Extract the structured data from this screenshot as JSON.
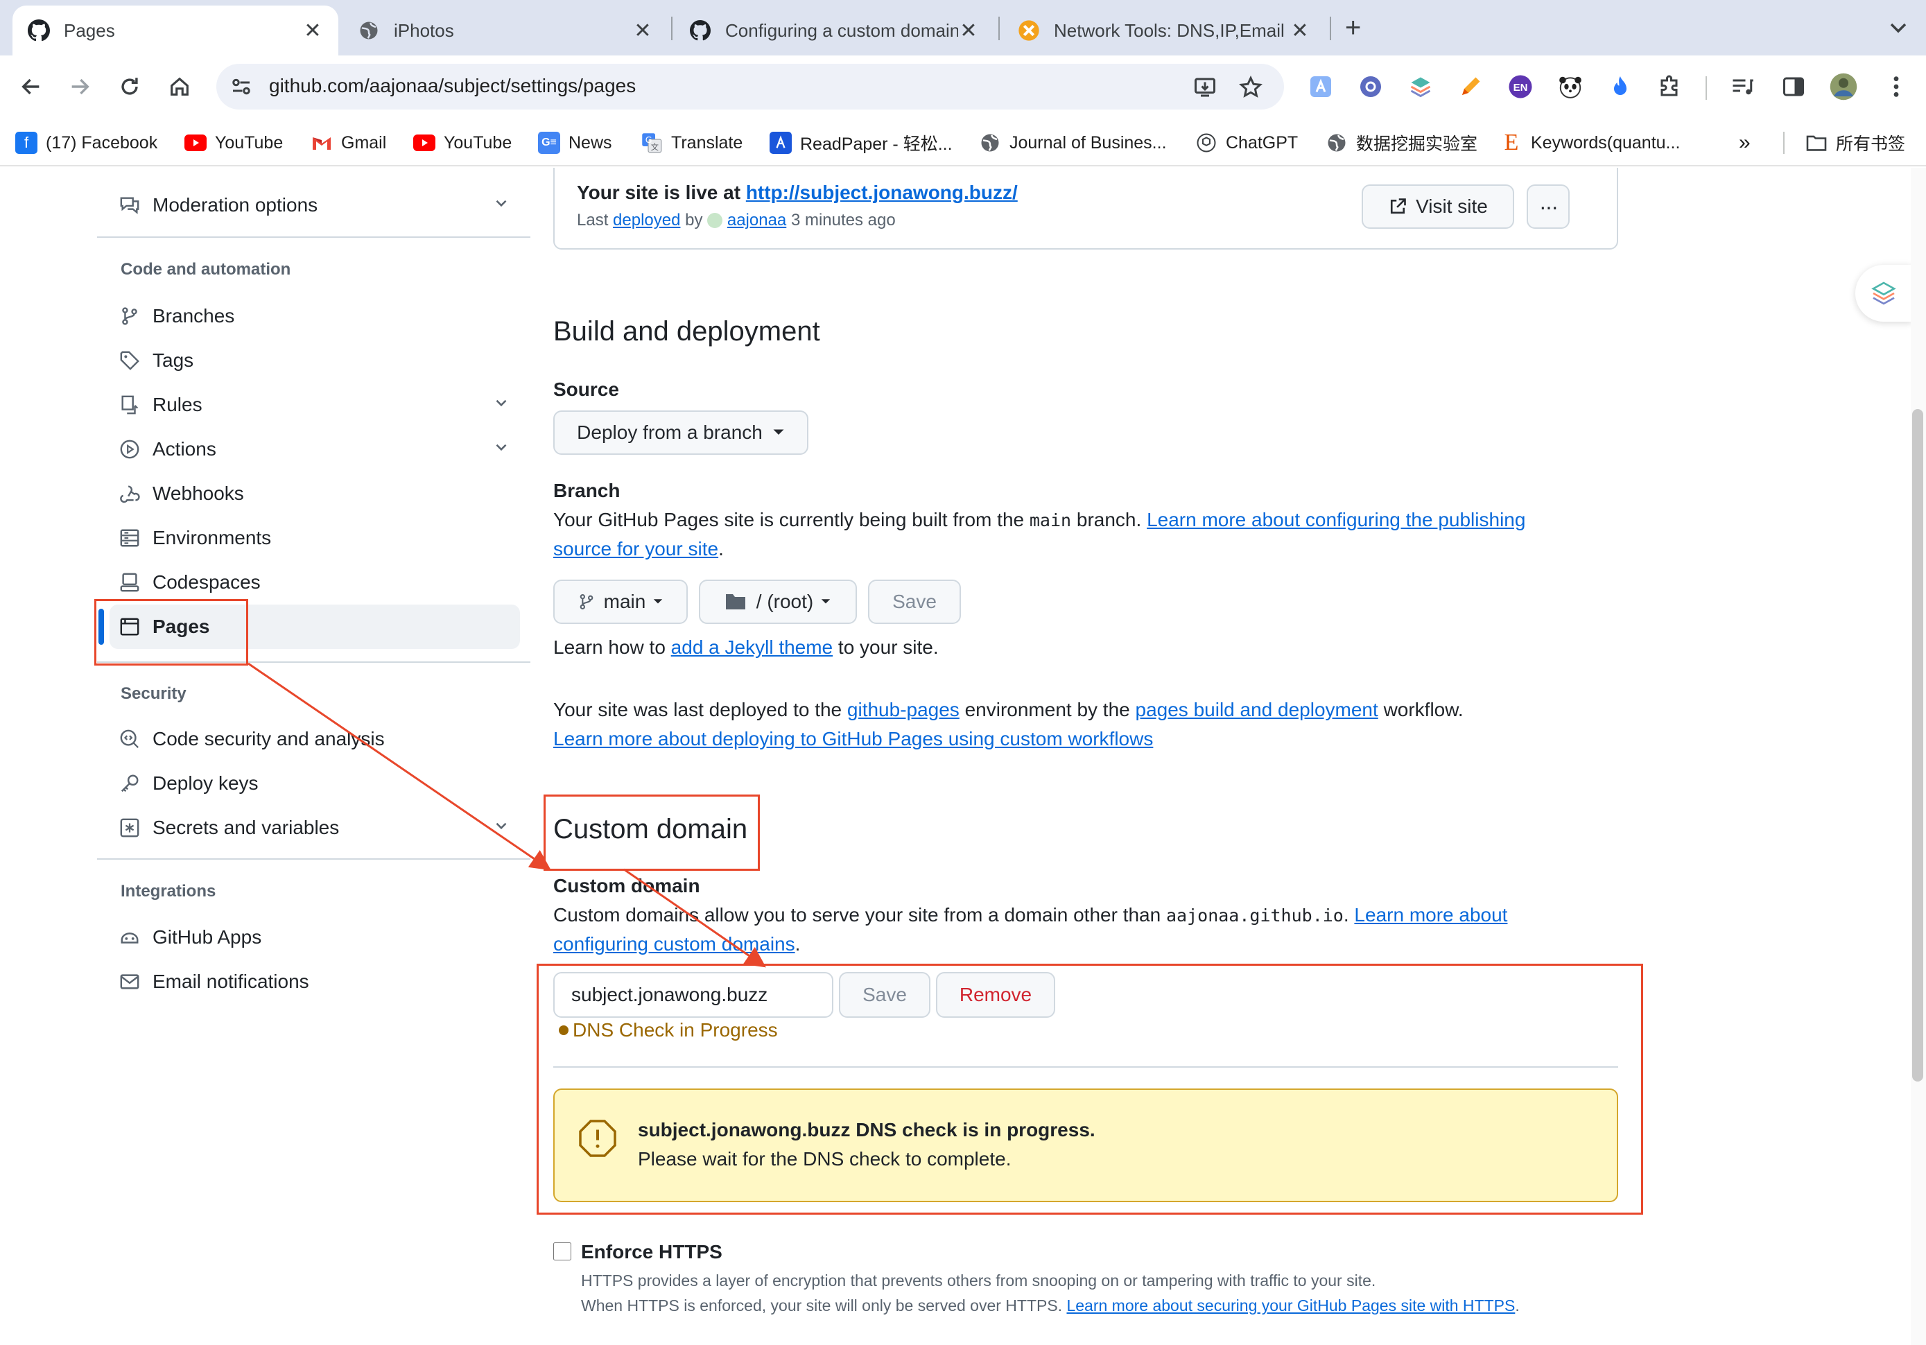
{
  "browser": {
    "tabs": [
      {
        "title": "Pages",
        "active": true,
        "icon": "github-icon"
      },
      {
        "title": "iPhotos",
        "active": false,
        "icon": "globe-icon"
      },
      {
        "title": "Configuring a custom domain",
        "active": false,
        "icon": "github-icon"
      },
      {
        "title": "Network Tools: DNS,IP,Email",
        "active": false,
        "icon": "network-tools-icon"
      }
    ],
    "address": "github.com/aajonaa/subject/settings/pages",
    "bookmarks": [
      "(17) Facebook",
      "YouTube",
      "Gmail",
      "YouTube",
      "News",
      "Translate",
      "ReadPaper - 轻松...",
      "Journal of Busines...",
      "ChatGPT",
      "数据挖掘实验室",
      "Keywords(quantu..."
    ],
    "all_bookmarks": "所有书签",
    "ext_en_label": "EN"
  },
  "sidebar": {
    "top_item": "Moderation options",
    "code_heading": "Code and automation",
    "code_items": [
      "Branches",
      "Tags",
      "Rules",
      "Actions",
      "Webhooks",
      "Environments",
      "Codespaces",
      "Pages"
    ],
    "security_heading": "Security",
    "security_items": [
      "Code security and analysis",
      "Deploy keys",
      "Secrets and variables"
    ],
    "integrations_heading": "Integrations",
    "integrations_items": [
      "GitHub Apps",
      "Email notifications"
    ],
    "selected": "Pages"
  },
  "live_banner": {
    "prefix": "Your site is live at",
    "url": "http://subject.jonawong.buzz/",
    "last": "Last",
    "deployed": "deployed",
    "by": "by",
    "user": "aajonaa",
    "time": "3 minutes ago",
    "visit_label": "Visit site",
    "more_label": "···"
  },
  "build": {
    "title": "Build and deployment",
    "source_label": "Source",
    "source_value": "Deploy from a branch",
    "branch_label": "Branch",
    "branch_text_1": "Your GitHub Pages site is currently being built from the",
    "branch_code": "main",
    "branch_text_2": "branch.",
    "branch_link_1": "Learn more about configuring the publishing",
    "branch_link_2": "source for your site",
    "branch_period": ".",
    "branch_btn": "main",
    "folder_btn": "/ (root)",
    "save_label": "Save",
    "jekyll_1": "Learn how to",
    "jekyll_link": "add a Jekyll theme",
    "jekyll_2": "to your site.",
    "deployed_1": "Your site was last deployed to the",
    "deployed_link_1": "github-pages",
    "deployed_2": "environment by the",
    "deployed_link_2": "pages build and deployment",
    "deployed_3": "workflow.",
    "workflows_link": "Learn more about deploying to GitHub Pages using custom workflows"
  },
  "custom_domain": {
    "title": "Custom domain",
    "label": "Custom domain",
    "desc_1": "Custom domains allow you to serve your site from a domain other than",
    "desc_code": "aajonaa.github.io",
    "desc_period": ".",
    "desc_link_1": "Learn more about",
    "desc_link_2": "configuring custom domains",
    "input_value": "subject.jonawong.buzz",
    "save_label": "Save",
    "remove_label": "Remove",
    "status": "DNS Check in Progress",
    "flash_title": "subject.jonawong.buzz DNS check is in progress.",
    "flash_body": "Please wait for the DNS check to complete."
  },
  "https": {
    "label": "Enforce HTTPS",
    "desc_1": "HTTPS provides a layer of encryption that prevents others from snooping on or tampering with traffic to your site.",
    "desc_2": "When HTTPS is enforced, your site will only be served over HTTPS.",
    "desc_link": "Learn more about securing your GitHub Pages site with HTTPS",
    "desc_period": "."
  },
  "colors": {
    "link": "#0969da",
    "annotation_red": "#e8472b",
    "warning_bg": "#fff8c5",
    "warning_border": "#d4a72c",
    "warning_text": "#9a6700",
    "danger": "#d1242f",
    "selected_bar": "#0969da"
  }
}
